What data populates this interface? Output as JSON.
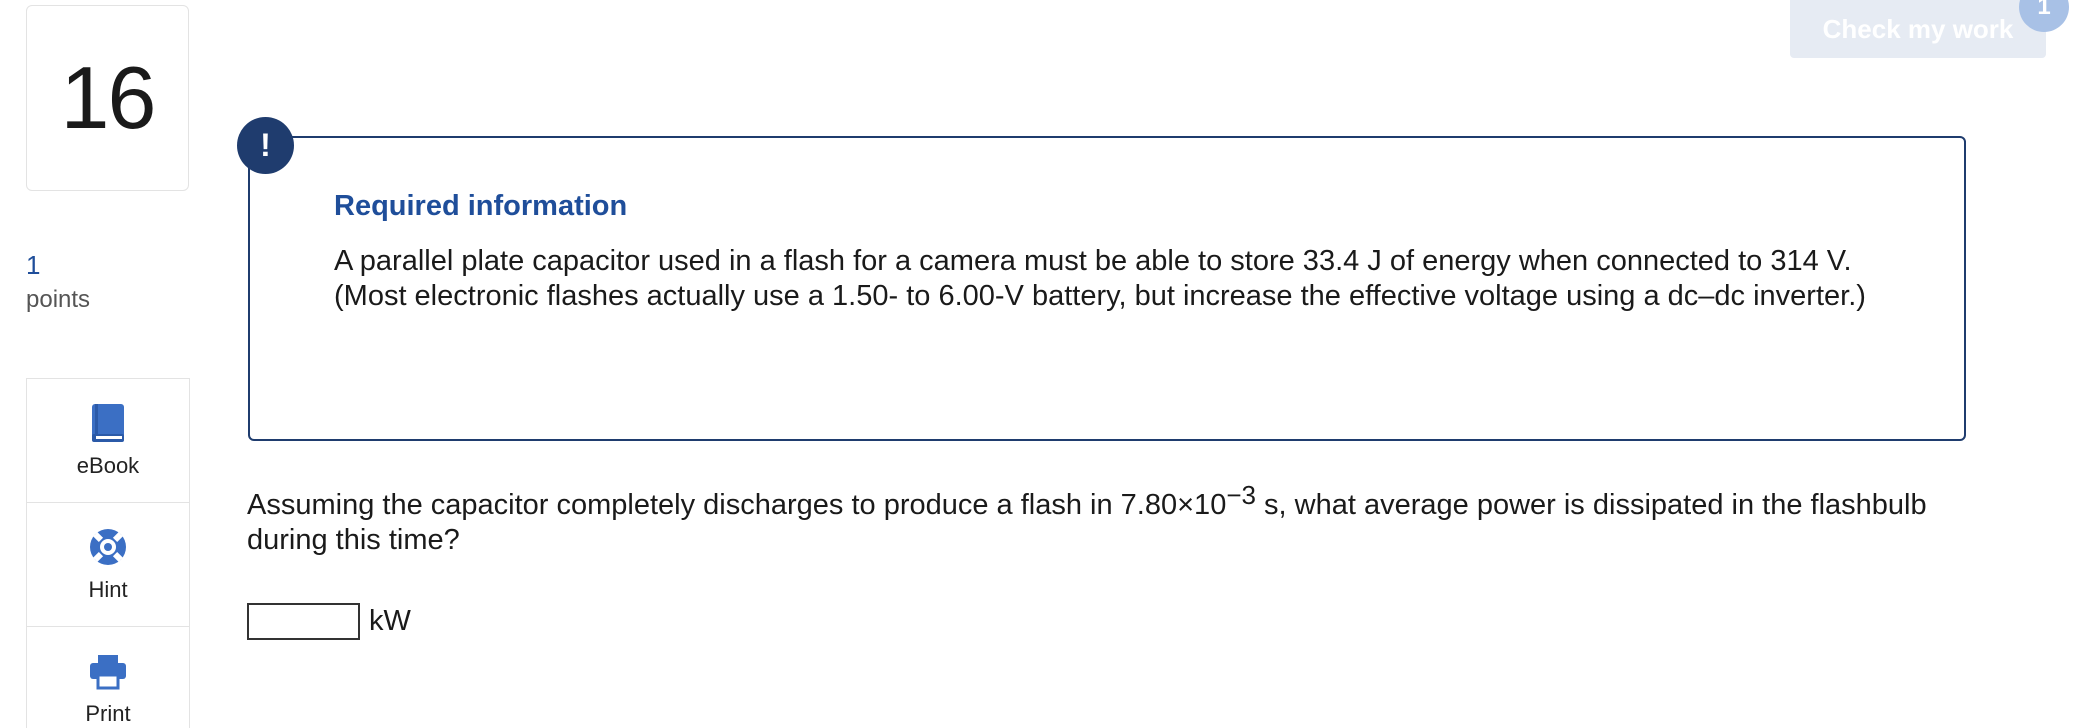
{
  "question": {
    "number": "16",
    "points_value": "1",
    "points_label": "points",
    "prompt_before_exp": "Assuming the capacitor completely discharges to produce a flash in 7.80×10",
    "prompt_exponent": "−3",
    "prompt_after_exp": " s, what average power is dissipated in the flashbulb during this time?",
    "answer_value": "",
    "answer_unit": "kW"
  },
  "tools": [
    {
      "label": "eBook",
      "icon": "book-icon"
    },
    {
      "label": "Hint",
      "icon": "lifebuoy-icon"
    },
    {
      "label": "Print",
      "icon": "printer-icon"
    }
  ],
  "header": {
    "check_label": "Check my work",
    "check_badge": "1"
  },
  "required_info": {
    "alert_symbol": "!",
    "title": "Required information",
    "text": "A parallel plate capacitor used in a flash for a camera must be able to store 33.4 J of energy when connected to 314 V. (Most electronic flashes actually use a 1.50- to 6.00-V battery, but increase the effective voltage using a dc–dc inverter.)"
  },
  "colors": {
    "accent_blue": "#1f4e9a",
    "icon_blue": "#3b6fc4",
    "box_border": "#1f3c6e",
    "check_bg": "#e6ebf3"
  }
}
